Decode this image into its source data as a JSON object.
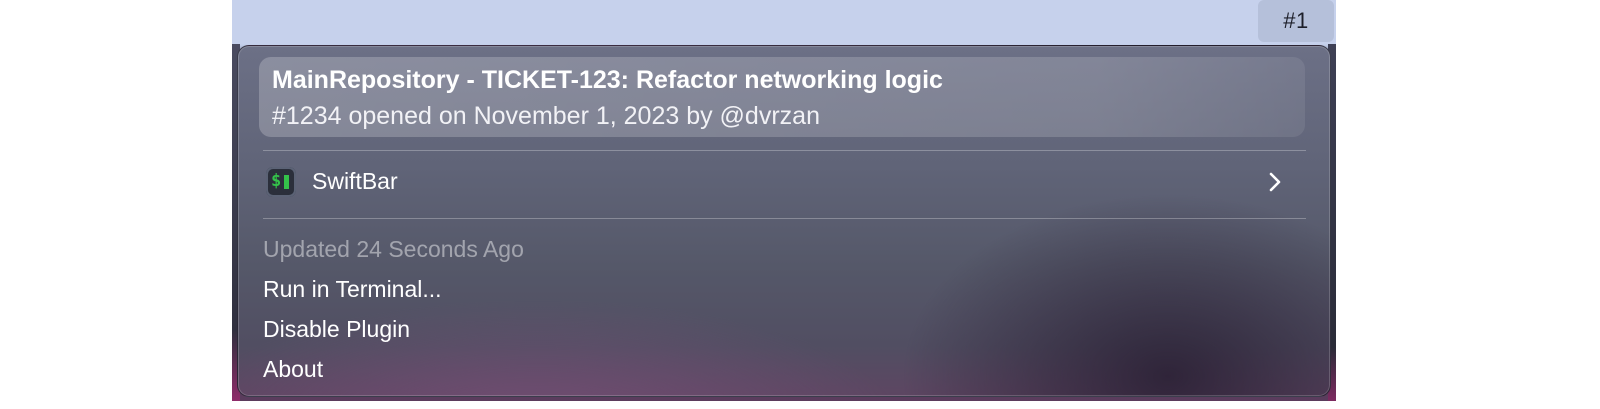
{
  "menubar": {
    "item_label": "#1"
  },
  "pull_request": {
    "title": "MainRepository - TICKET-123: Refactor networking logic",
    "subtitle": "#1234 opened on November 1, 2023 by @dvrzan"
  },
  "app_row": {
    "icon": "swiftbar-app-icon",
    "label": "SwiftBar",
    "submenu_icon": "chevron-right-icon"
  },
  "menu": {
    "updated_label": "Updated 24 Seconds Ago",
    "run_label": "Run in Terminal...",
    "disable_label": "Disable Plugin",
    "about_label": "About"
  },
  "colors": {
    "menubar_bg": "#c6d1ec",
    "menubar_item_bg": "#b5c0da",
    "swiftbar_green": "#34c24a"
  }
}
